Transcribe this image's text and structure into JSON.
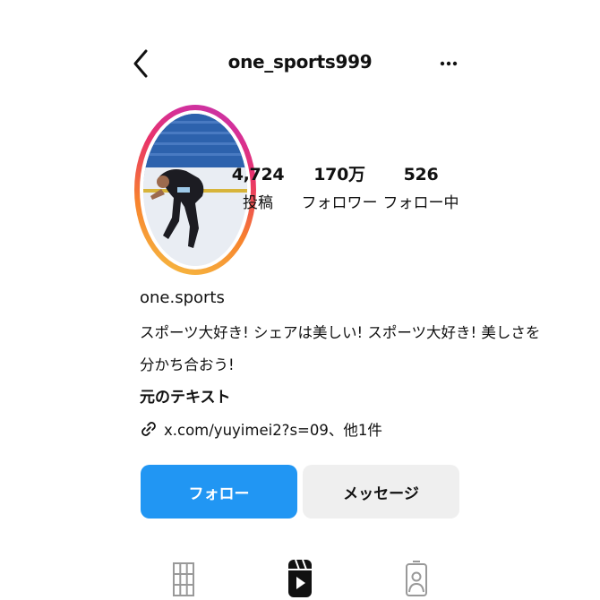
{
  "header": {
    "username": "one_sports999",
    "back_icon": "chevron-left-icon",
    "more_icon": "more-horizontal-icon"
  },
  "profile": {
    "avatar_icon": "avatar",
    "stats": [
      {
        "value": "4,724",
        "label": "投稿"
      },
      {
        "value": "170万",
        "label": "フォロワー"
      },
      {
        "value": "526",
        "label": "フォロー中"
      }
    ],
    "display_name": "one.sports",
    "bio_line1": "スポーツ大好き! シェアは美しい! スポーツ大好き! 美しさを",
    "bio_line2": "分かち合おう!",
    "original_text": "元のテキスト",
    "link_text": "x.com/yuyimei2?s=09、他1件",
    "link_icon": "link-icon"
  },
  "actions": {
    "follow_label": "フォロー",
    "message_label": "メッセージ",
    "follow_color": "#2196f3",
    "message_color": "#efefef"
  },
  "tabs": [
    {
      "icon": "grid-icon",
      "active": false
    },
    {
      "icon": "reels-icon",
      "active": true
    },
    {
      "icon": "tagged-icon",
      "active": false
    }
  ]
}
